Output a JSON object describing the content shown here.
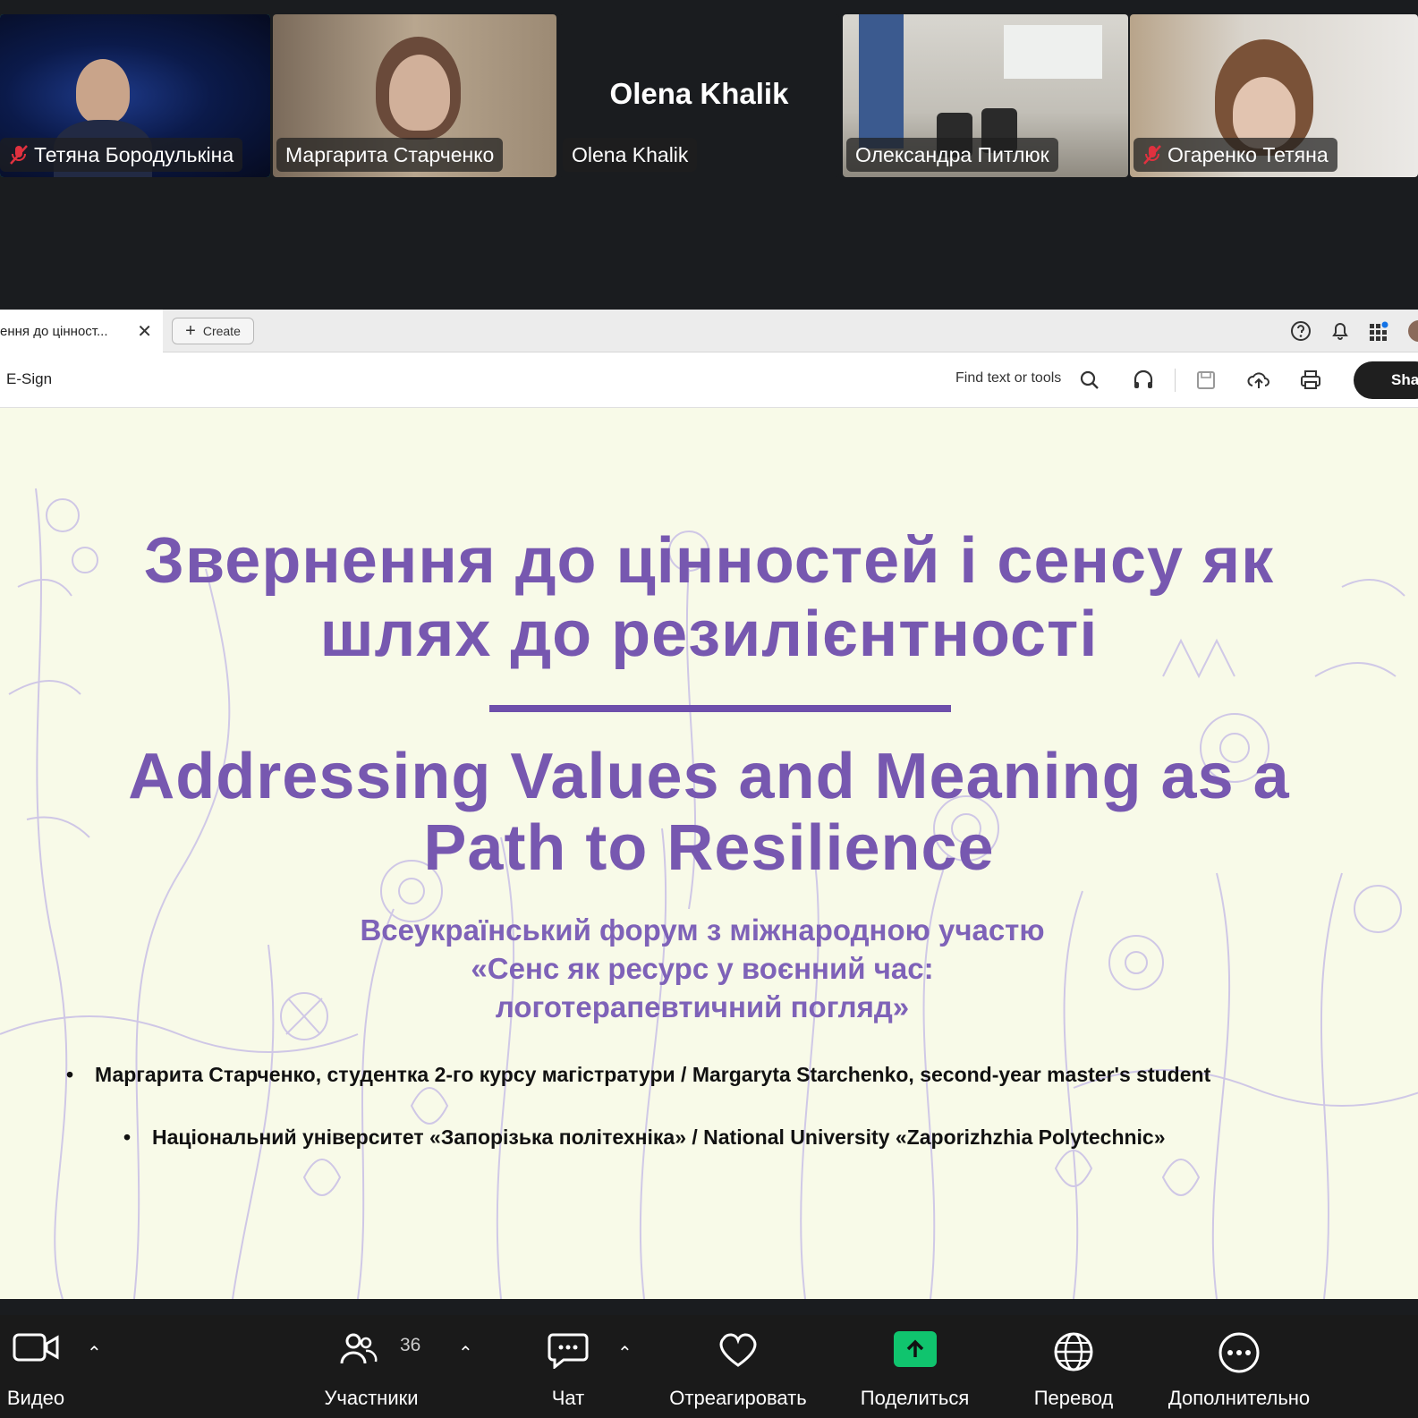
{
  "participants": [
    {
      "name": "Тетяна Бородулькіна",
      "muted": true,
      "active": true
    },
    {
      "name": "Маргарита Старченко",
      "muted": false,
      "active": false
    },
    {
      "name": "Olena Khalik",
      "muted": false,
      "active": false,
      "display_name": "Olena Khalik"
    },
    {
      "name": "Олександра Питлюк",
      "muted": false,
      "active": false
    },
    {
      "name": "Огаренко Тетяна",
      "muted": true,
      "active": false
    }
  ],
  "browser": {
    "tab_title": "ення до цінност...",
    "tab_close": "✕",
    "create_label": "Create"
  },
  "toolbar": {
    "esign": "E-Sign",
    "find_placeholder": "Find text or tools",
    "share_label": "Share"
  },
  "slide": {
    "title_ua_line1": "Звернення до цінностей і сенсу як",
    "title_ua_line2": "шлях до резилієнтності",
    "title_en_line1": "Addressing Values and Meaning as a",
    "title_en_line2": "Path to Resilience",
    "forum_line1": "Всеукраїнський форум з міжнародною участю",
    "forum_line2": "«Сенс як ресурс у воєнний час:",
    "forum_line3": "логотерапевтичний погляд»",
    "bullet1": "Маргарита Старченко, студентка 2-го курсу  магістратури / Margaryta Starchenko, second-year master's student",
    "bullet2": "Національний університет «Запорізька політехніка» /  National University «Zaporizhzhia Polytechnic»"
  },
  "controls": {
    "video": "Видео",
    "participants": "Участники",
    "participants_count": "36",
    "chat": "Чат",
    "react": "Отреагировать",
    "share": "Поделиться",
    "translate": "Перевод",
    "more": "Дополнительно"
  },
  "colors": {
    "accent_active": "#23d9a0",
    "slide_purple": "#7758b0",
    "share_green": "#10c46e",
    "muted_red": "#e0313f"
  }
}
